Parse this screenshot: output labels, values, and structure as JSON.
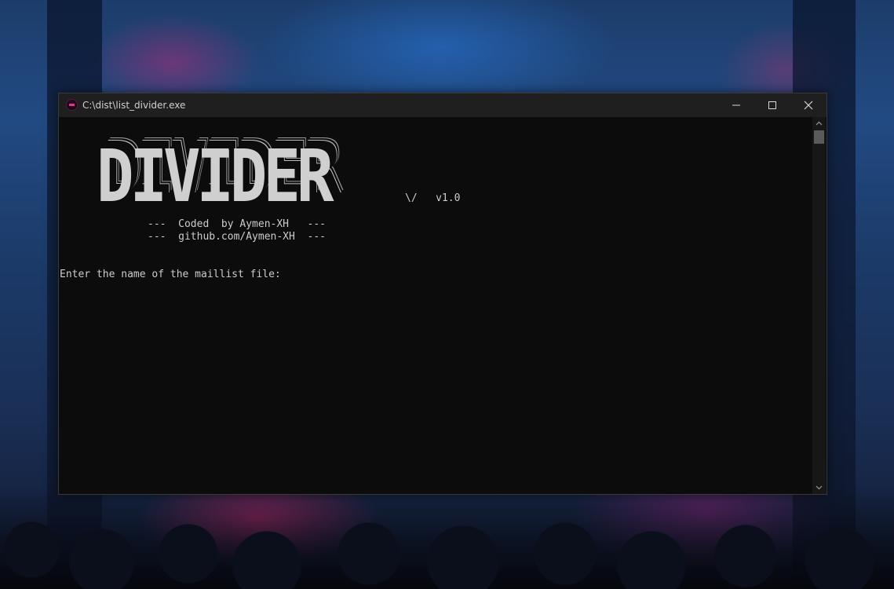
{
  "window": {
    "title": "C:\\dist\\list_divider.exe",
    "icon": "app-icon",
    "controls": {
      "minimize_icon": "minimize-icon",
      "maximize_icon": "maximize-icon",
      "close_icon": "close-icon"
    }
  },
  "console": {
    "banner": "DIVIDER",
    "version_line": "\\/   v1.0",
    "credit_lines": [
      "---  Coded  by Aymen-XH   ---",
      "---  github.com/Aymen-XH  ---"
    ],
    "prompt": "Enter the name of the maillist file:",
    "input_value": ""
  },
  "colors": {
    "console_background": "#0c0c0c",
    "console_text": "#cccccc",
    "titlebar": "#1f1f1f"
  }
}
